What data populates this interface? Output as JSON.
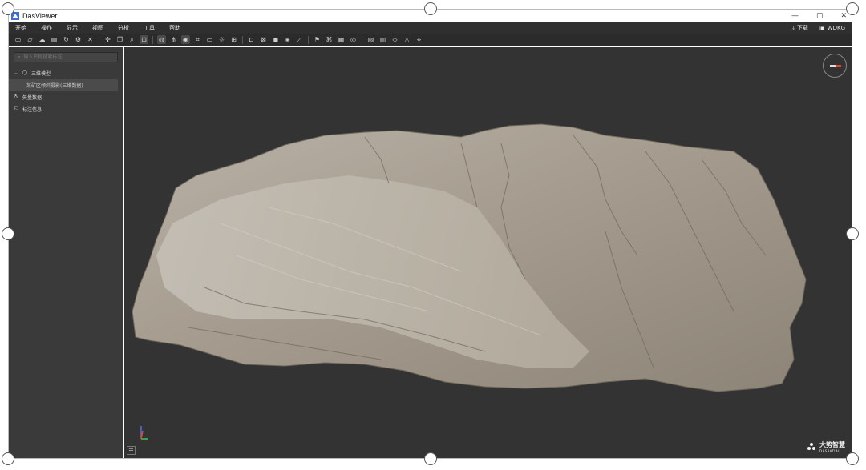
{
  "window": {
    "title": "DasViewer",
    "minimize": "—",
    "maximize": "▢",
    "close": "✕"
  },
  "menu": {
    "items": [
      "开始",
      "操作",
      "显示",
      "视图",
      "分析",
      "工具",
      "帮助"
    ],
    "download_label": "下载",
    "user_label": "WDKG"
  },
  "toolbar": {
    "icons": [
      "new-icon",
      "open-folder-icon",
      "cloud-icon",
      "save-icon",
      "refresh-icon",
      "settings-icon",
      "close-icon",
      "move-icon",
      "copy-icon",
      "zoom-icon",
      "select-icon",
      "globe-icon",
      "tree-icon",
      "sphere-icon",
      "frame-icon",
      "monitor-icon",
      "sun-icon",
      "grid-icon",
      "measure-icon",
      "area-icon",
      "volume-icon",
      "profile-icon",
      "slope-icon",
      "flag-icon",
      "tag-icon",
      "image-icon",
      "location-icon",
      "clip-icon",
      "layer-icon",
      "cube-icon",
      "triangle-icon",
      "fly-icon"
    ]
  },
  "sidebar": {
    "search_placeholder": "输入名称搜索标注",
    "tree": {
      "root_label": "三维模型",
      "child_label": "某矿区倾斜摄影(三维数据)",
      "item2_label": "矢量数据",
      "item3_label": "标注信息"
    }
  },
  "viewport": {
    "brand_name": "大势智慧",
    "brand_sub": "DASPATIAL"
  },
  "colors": {
    "background": "#333333",
    "panel": "#3a3a3a",
    "menubar": "#2f2f2f",
    "accent": "#e04b2c"
  }
}
